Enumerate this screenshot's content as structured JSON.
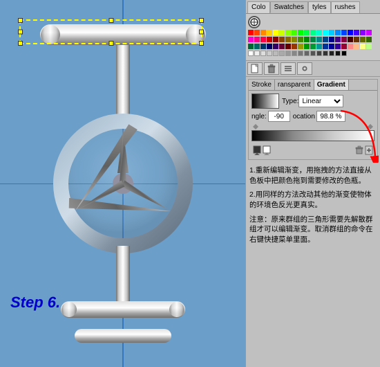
{
  "canvas": {
    "bg_color": "#6b9ec8",
    "step_label": "Step 6."
  },
  "right_panel": {
    "tabs": [
      {
        "label": "Colo",
        "active": false
      },
      {
        "label": "Swatches",
        "active": true
      },
      {
        "label": "tyles",
        "active": false
      },
      {
        "label": "rushes",
        "active": false
      }
    ],
    "gradient_panel": {
      "tabs": [
        {
          "label": "Stroke",
          "active": false
        },
        {
          "label": "ransparent",
          "active": false
        },
        {
          "label": "Gradient",
          "active": true
        }
      ],
      "type_label": "Type:",
      "type_value": "Linear",
      "angle_label": "ngle:",
      "angle_value": "-90",
      "location_label": "ocation",
      "location_value": "98.8 %"
    },
    "instructions": [
      {
        "number": "1.",
        "text": "重新编辑渐变，用拖拽的方法直接从色板中把颜色拖到需要修改的色瓶。"
      },
      {
        "number": "2.",
        "text": "用同样的方法改动其他的渐变使物体的环境色反光更真实。"
      },
      {
        "number": "注意：",
        "text": "原来群组的三角形需要先解散群组才可以编辑渐变。取消群组的命令在右键快捷菜单里面。"
      }
    ]
  },
  "swatches": {
    "colors_row1": [
      "#ff0000",
      "#ff4400",
      "#ff8800",
      "#ffcc00",
      "#ffff00",
      "#ccff00",
      "#88ff00",
      "#44ff00",
      "#00ff00",
      "#00ff44",
      "#00ff88",
      "#00ffcc",
      "#00ffff",
      "#00ccff",
      "#0088ff",
      "#0044ff",
      "#0000ff",
      "#4400ff",
      "#8800ff",
      "#cc00ff"
    ],
    "colors_row2": [
      "#ff00cc",
      "#ff0088",
      "#ff0044",
      "#cc0000",
      "#880000",
      "#884400",
      "#886600",
      "#888800",
      "#448800",
      "#008800",
      "#008844",
      "#008888",
      "#004488",
      "#000088",
      "#440088",
      "#880044",
      "#440000",
      "#663300",
      "#666600",
      "#336600"
    ],
    "colors_row3": [
      "#006633",
      "#006666",
      "#003366",
      "#000066",
      "#330066",
      "#660033",
      "#660000",
      "#993300",
      "#999900",
      "#009900",
      "#009933",
      "#009999",
      "#003399",
      "#000099",
      "#330099",
      "#990033",
      "#ff8888",
      "#ffbb88",
      "#ffff88",
      "#bbff88"
    ],
    "grayscale": [
      "#ffffff",
      "#eeeeee",
      "#dddddd",
      "#cccccc",
      "#bbbbbb",
      "#aaaaaa",
      "#999999",
      "#888888",
      "#777777",
      "#666666",
      "#555555",
      "#444444",
      "#333333",
      "#222222",
      "#111111",
      "#000000"
    ]
  }
}
